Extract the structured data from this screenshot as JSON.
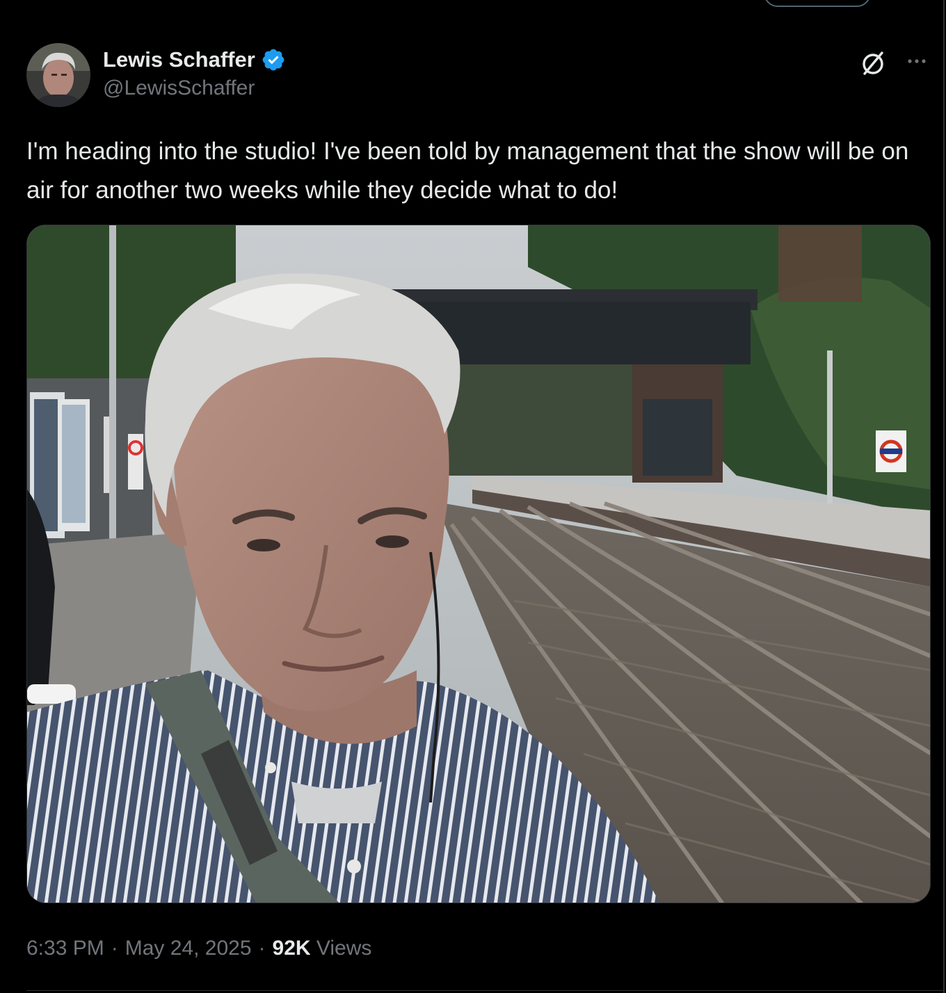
{
  "author": {
    "display_name": "Lewis Schaffer",
    "handle": "@LewisSchaffer",
    "verified": true
  },
  "tweet": {
    "text": "I'm heading into the studio! I've been told by management that the show will be on air for another two weeks while they decide what to do!",
    "time": "6:33 PM",
    "separator": "·",
    "date": "May 24, 2025",
    "views_count": "92K",
    "views_label": "Views"
  },
  "icons": {
    "verified": "verified-badge-icon",
    "grok": "grok-icon",
    "more": "more-options-icon"
  },
  "colors": {
    "background": "#000000",
    "text_primary": "#e7e9ea",
    "text_secondary": "#71767b",
    "verified_blue": "#1d9bf0",
    "border": "#2f3336"
  }
}
